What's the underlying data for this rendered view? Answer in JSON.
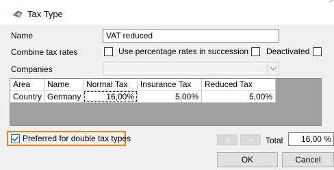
{
  "window": {
    "title": "Tax Type"
  },
  "form": {
    "name_label": "Name",
    "name_value": "VAT reduced",
    "combine_label": "Combine tax rates",
    "use_percentage_label": "Use percentage rates in succession",
    "use_percentage_checked": false,
    "deactivated_label": "Deactivated",
    "deactivated_checked": false,
    "companies_label": "Companies",
    "companies_value": ""
  },
  "grid": {
    "columns": [
      "Area",
      "Name",
      "Normal Tax",
      "Insurance Tax",
      "Reduced Tax"
    ],
    "rows": [
      {
        "area": "Country",
        "name": "Germany",
        "normal": "16,00%",
        "insurance": "5,00%",
        "reduced": "5,00%"
      }
    ]
  },
  "footer": {
    "preferred_label": "Preferred for double tax types",
    "preferred_checked": true,
    "total_label": "Total",
    "total_value": "16,00 %",
    "ok_label": "OK",
    "cancel_label": "Cancel"
  },
  "colors": {
    "highlight": "#f0801a",
    "checkmark": "#0066cc"
  }
}
